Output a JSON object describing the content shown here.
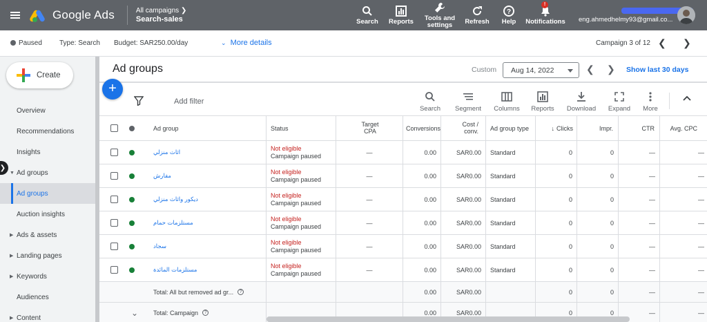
{
  "header": {
    "product": "Google Ads",
    "breadcrumb_top": "All campaigns",
    "breadcrumb_campaign": "Search-sales",
    "nav": [
      {
        "label": "Search"
      },
      {
        "label": "Reports"
      },
      {
        "label": "Tools and\nsettings"
      },
      {
        "label": "Refresh"
      },
      {
        "label": "Help"
      },
      {
        "label": "Notifications",
        "badge": "!"
      }
    ],
    "email": "eng.ahmedhelmy93@gmail.co..."
  },
  "subbar": {
    "status": "Paused",
    "type": "Type: Search",
    "budget": "Budget: SAR250.00/day",
    "more_details": "More details",
    "campaign_position": "Campaign 3 of 12"
  },
  "sidebar": {
    "create": "Create",
    "items": [
      {
        "label": "Overview"
      },
      {
        "label": "Recommendations"
      },
      {
        "label": "Insights"
      },
      {
        "label": "Ad groups"
      },
      {
        "label": "Ad groups"
      },
      {
        "label": "Auction insights"
      },
      {
        "label": "Ads & assets"
      },
      {
        "label": "Landing pages"
      },
      {
        "label": "Keywords"
      },
      {
        "label": "Audiences"
      },
      {
        "label": "Content"
      }
    ]
  },
  "main": {
    "title": "Ad groups",
    "custom_label": "Custom",
    "date": "Aug 14, 2022",
    "show_last": "Show last 30 days",
    "add_filter": "Add filter",
    "tools": [
      {
        "label": "Search"
      },
      {
        "label": "Segment"
      },
      {
        "label": "Columns"
      },
      {
        "label": "Reports"
      },
      {
        "label": "Download"
      },
      {
        "label": "Expand"
      },
      {
        "label": "More"
      }
    ],
    "columns": {
      "ad_group": "Ad group",
      "status": "Status",
      "target_cpa": "Target\nCPA",
      "conversions": "Conversions",
      "cost_conv": "Cost /\nconv.",
      "ad_group_type": "Ad group type",
      "clicks": "Clicks",
      "impr": "Impr.",
      "ctr": "CTR",
      "avg_cpc": "Avg. CPC"
    },
    "rows": [
      {
        "name": "اثاث منزلي",
        "status1": "Not eligible",
        "status2": "Campaign paused",
        "target_cpa": "—",
        "conversions": "0.00",
        "cost_conv": "SAR0.00",
        "type": "Standard",
        "clicks": "0",
        "impr": "0",
        "ctr": "—",
        "avg_cpc": "—"
      },
      {
        "name": "مفارش",
        "status1": "Not eligible",
        "status2": "Campaign paused",
        "target_cpa": "—",
        "conversions": "0.00",
        "cost_conv": "SAR0.00",
        "type": "Standard",
        "clicks": "0",
        "impr": "0",
        "ctr": "—",
        "avg_cpc": "—"
      },
      {
        "name": "ديكور واثاث منزلي",
        "status1": "Not eligible",
        "status2": "Campaign paused",
        "target_cpa": "—",
        "conversions": "0.00",
        "cost_conv": "SAR0.00",
        "type": "Standard",
        "clicks": "0",
        "impr": "0",
        "ctr": "—",
        "avg_cpc": "—"
      },
      {
        "name": "مستلزمات حمام",
        "status1": "Not eligible",
        "status2": "Campaign paused",
        "target_cpa": "—",
        "conversions": "0.00",
        "cost_conv": "SAR0.00",
        "type": "Standard",
        "clicks": "0",
        "impr": "0",
        "ctr": "—",
        "avg_cpc": "—"
      },
      {
        "name": "سجاد",
        "status1": "Not eligible",
        "status2": "Campaign paused",
        "target_cpa": "—",
        "conversions": "0.00",
        "cost_conv": "SAR0.00",
        "type": "Standard",
        "clicks": "0",
        "impr": "0",
        "ctr": "—",
        "avg_cpc": "—"
      },
      {
        "name": "مستلزمات المائدة",
        "status1": "Not eligible",
        "status2": "Campaign paused",
        "target_cpa": "—",
        "conversions": "0.00",
        "cost_conv": "SAR0.00",
        "type": "Standard",
        "clicks": "0",
        "impr": "0",
        "ctr": "—",
        "avg_cpc": "—"
      }
    ],
    "totals": [
      {
        "label": "Total: All but removed ad gr...",
        "conversions": "0.00",
        "cost_conv": "SAR0.00",
        "clicks": "0",
        "impr": "0",
        "ctr": "—",
        "avg_cpc": "—"
      },
      {
        "label": "Total: Campaign",
        "conversions": "0.00",
        "cost_conv": "SAR0.00",
        "clicks": "0",
        "impr": "0",
        "ctr": "—",
        "avg_cpc": "—"
      }
    ]
  },
  "colors": {
    "topbar": "#5f6368",
    "accent": "#1a73e8",
    "eligible_dot": "#188038",
    "not_eligible": "#c5221f"
  }
}
